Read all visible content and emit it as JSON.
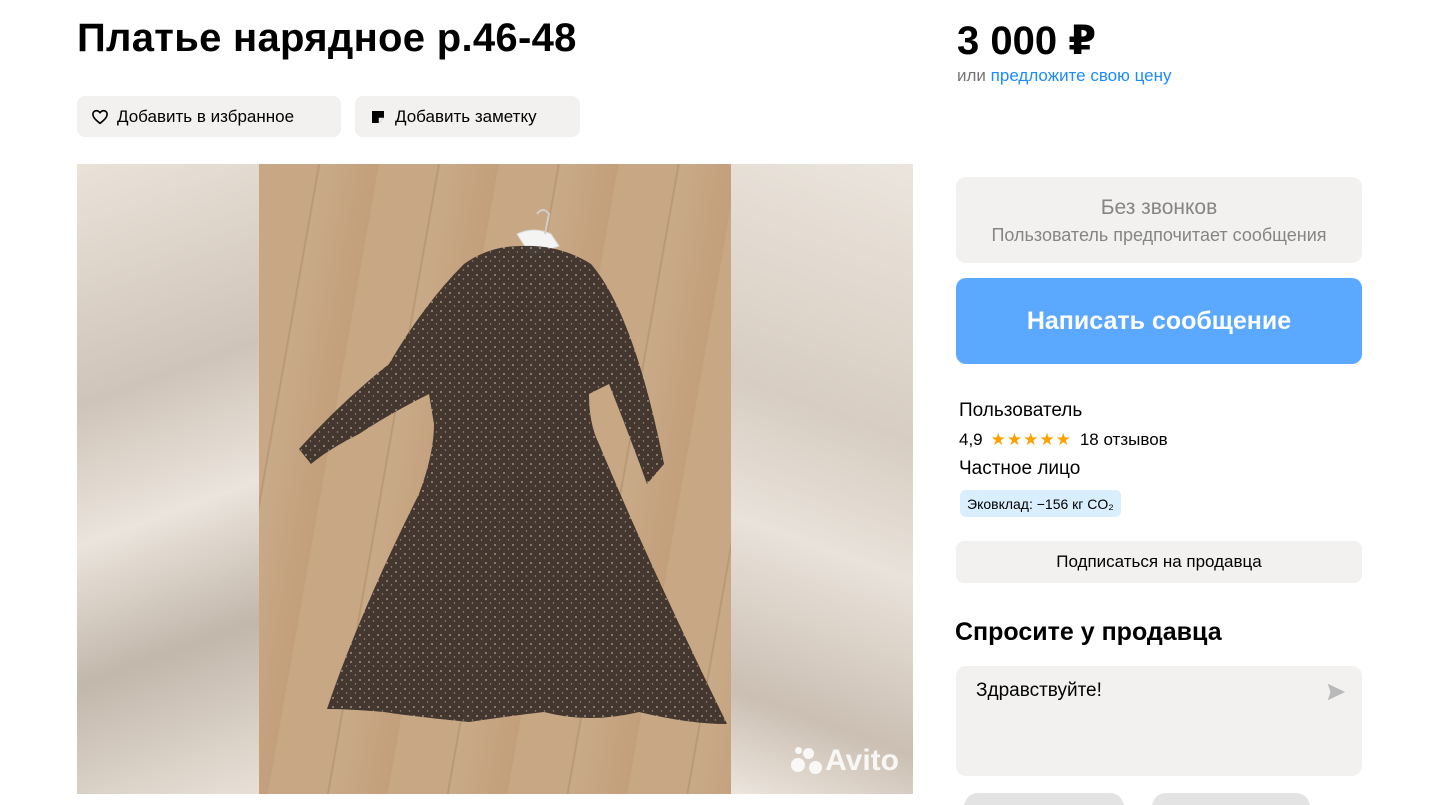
{
  "listing": {
    "title": "Платье нарядное р.46-48",
    "price": "3 000 ₽",
    "offer_prefix": "или",
    "offer_link": "предложите свою цену"
  },
  "actions": {
    "favorite_label": "Добавить в избранное",
    "note_label": "Добавить заметку"
  },
  "gallery": {
    "watermark": "Avito"
  },
  "contact": {
    "no_calls_title": "Без звонков",
    "no_calls_subtitle": "Пользователь предпочитает сообщения",
    "message_button": "Написать сообщение"
  },
  "seller": {
    "name": "Пользователь",
    "rating": "4,9",
    "stars": "★★★★★",
    "reviews": "18 отзывов",
    "type": "Частное лицо",
    "eco_badge": "Эковклад: −156 кг CO₂",
    "subscribe_button": "Подписаться на продавца"
  },
  "ask": {
    "title": "Спросите у продавца",
    "message": "Здравствуйте!"
  },
  "colors": {
    "accent_blue": "#5aa8ff",
    "link_blue": "#1a8cff",
    "star": "#ffa200",
    "chip_bg": "#f2f1f0",
    "eco_bg": "#d9efff"
  },
  "icons": {
    "favorite": "heart-icon",
    "note": "note-icon",
    "send": "send-icon",
    "watermark_logo": "avito-logo"
  }
}
